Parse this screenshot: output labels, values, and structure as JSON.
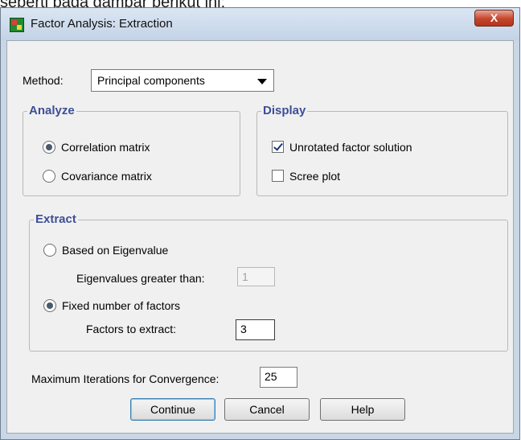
{
  "background": {
    "caption": "seperti pada gambar berikut ini:"
  },
  "window": {
    "title": "Factor Analysis: Extraction",
    "close_glyph": "X"
  },
  "method": {
    "label": "Method:",
    "selected": "Principal components"
  },
  "analyze": {
    "legend": "Analyze",
    "options": [
      {
        "label": "Correlation matrix",
        "checked": true
      },
      {
        "label": "Covariance matrix",
        "checked": false
      }
    ]
  },
  "display": {
    "legend": "Display",
    "options": [
      {
        "label": "Unrotated factor solution",
        "checked": true
      },
      {
        "label": "Scree plot",
        "checked": false
      }
    ]
  },
  "extract": {
    "legend": "Extract",
    "eigen_radio": "Based on Eigenvalue",
    "eigen_label": "Eigenvalues greater than:",
    "eigen_value": "1",
    "fixed_radio": "Fixed number of factors",
    "factors_label": "Factors to extract:",
    "factors_value": "3"
  },
  "iterations": {
    "label": "Maximum Iterations for Convergence:",
    "value": "25"
  },
  "buttons": {
    "continue": "Continue",
    "cancel": "Cancel",
    "help": "Help"
  },
  "colors": {
    "legend": "#3c4f97",
    "titlebar": "#c3d3e6",
    "close": "#c4452b"
  }
}
